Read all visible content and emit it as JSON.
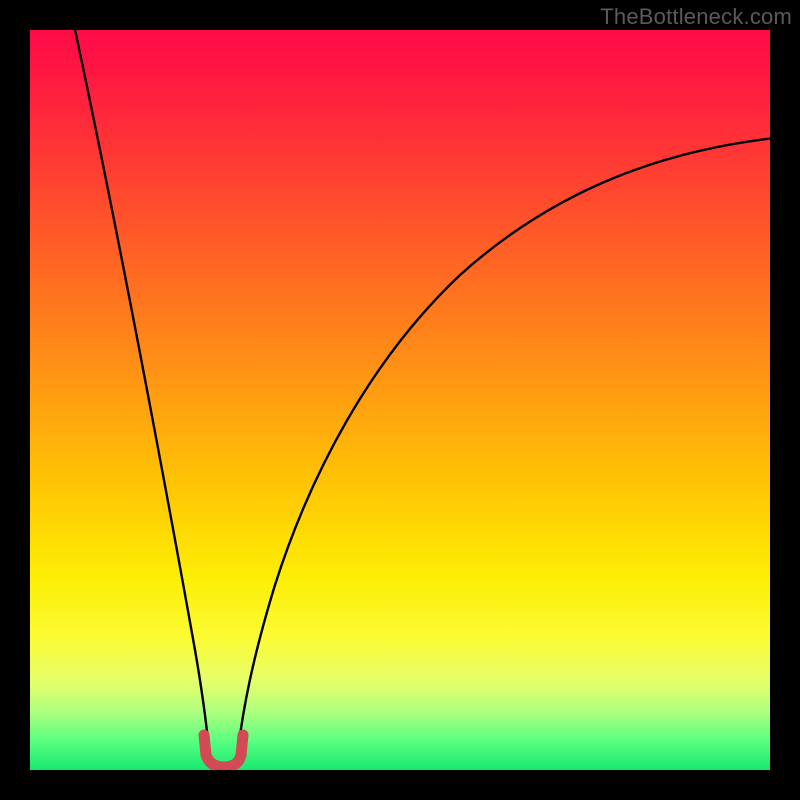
{
  "watermark": "TheBottleneck.com",
  "colors": {
    "curve": "#000000",
    "marker": "#d14a55",
    "frame": "#000000"
  },
  "chart_data": {
    "type": "line",
    "title": "",
    "xlabel": "",
    "ylabel": "",
    "xlim": [
      0,
      100
    ],
    "ylim": [
      0,
      100
    ],
    "grid": false,
    "series": [
      {
        "name": "left-branch",
        "x": [
          6,
          8,
          10,
          12,
          14,
          16,
          18,
          20,
          21.5,
          22.5,
          23,
          23.5,
          24
        ],
        "y": [
          100,
          90,
          80,
          70,
          60,
          49,
          37,
          24,
          14,
          7,
          4,
          2,
          1
        ]
      },
      {
        "name": "right-branch",
        "x": [
          28,
          28.5,
          29,
          30,
          31.5,
          34,
          38,
          43,
          49,
          56,
          64,
          73,
          82,
          91,
          100
        ],
        "y": [
          1,
          2,
          4,
          8,
          14,
          24,
          37,
          48,
          57,
          65,
          71,
          76,
          80,
          83,
          85
        ]
      },
      {
        "name": "bottom-marker",
        "x": [
          23.5,
          24,
          25,
          26,
          27,
          28,
          28.5
        ],
        "y": [
          4,
          1,
          0,
          0,
          0,
          1,
          4
        ]
      }
    ],
    "annotations": [
      {
        "text": "TheBottleneck.com",
        "position": "top-right"
      }
    ]
  }
}
